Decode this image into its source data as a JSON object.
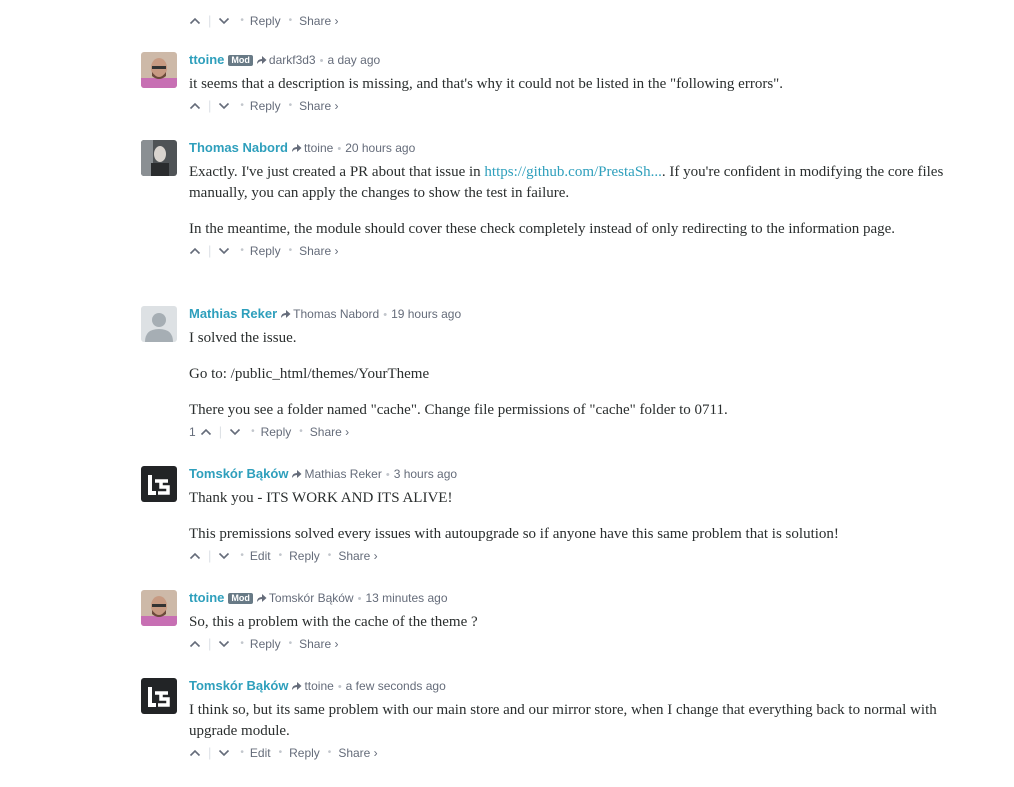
{
  "top_actions": {
    "reply": "Reply",
    "share": "Share ›"
  },
  "comments": [
    {
      "author": "ttoine",
      "badge": "Mod",
      "parent": "darkf3d3",
      "time": "a day ago",
      "paragraphs": [
        "it seems that a description is missing, and that's why it could not be listed in the \"following errors\"."
      ],
      "votes": "",
      "actions": [
        "Reply",
        "Share ›"
      ]
    },
    {
      "author": "Thomas Nabord",
      "badge": "",
      "parent": "ttoine",
      "time": "20 hours ago",
      "p1_before": "Exactly. I've just created a PR about that issue in ",
      "p1_link": "https://github.com/PrestaSh...",
      "p1_after": ". If you're confident in modifying the core files manually, you can apply the changes to show the test in failure.",
      "p2": "In the meantime, the module should cover these check completely instead of only redirecting to the information page.",
      "actions": [
        "Reply",
        "Share ›"
      ]
    },
    {
      "author": "Mathias Reker",
      "parent": "Thomas Nabord",
      "time": "19 hours ago",
      "paragraphs": [
        "I solved the issue.",
        "Go to: /public_html/themes/YourTheme",
        "There you see a folder named \"cache\". Change file permissions of \"cache\" folder to 0711."
      ],
      "votes": "1",
      "actions": [
        "Reply",
        "Share ›"
      ]
    },
    {
      "author": "Tomskór Bąków",
      "parent": "Mathias Reker",
      "time": "3 hours ago",
      "paragraphs": [
        "Thank you - ITS WORK AND ITS ALIVE!",
        "This premissions solved every issues with autoupgrade so if anyone have this same problem that is solution!"
      ],
      "actions": [
        "Edit",
        "Reply",
        "Share ›"
      ]
    },
    {
      "author": "ttoine",
      "badge": "Mod",
      "parent": "Tomskór Bąków",
      "time": "13 minutes ago",
      "paragraphs": [
        "So, this a problem with the cache of the theme ?"
      ],
      "actions": [
        "Reply",
        "Share ›"
      ]
    },
    {
      "author": "Tomskór Bąków",
      "parent": "ttoine",
      "time": "a few seconds ago",
      "paragraphs": [
        "I think so, but its same problem with our main store and our mirror store, when I change that everything back to normal with upgrade module."
      ],
      "actions": [
        "Edit",
        "Reply",
        "Share ›"
      ]
    }
  ],
  "colors": {
    "author_link": "#2e9fbc",
    "meta": "#656c7a",
    "mod_badge": "#687a86",
    "text": "#2a2e2e"
  },
  "icons": [
    "upvote-icon",
    "downvote-icon",
    "reply-arrow-icon",
    "avatar-icon",
    "default-avatar-icon"
  ]
}
